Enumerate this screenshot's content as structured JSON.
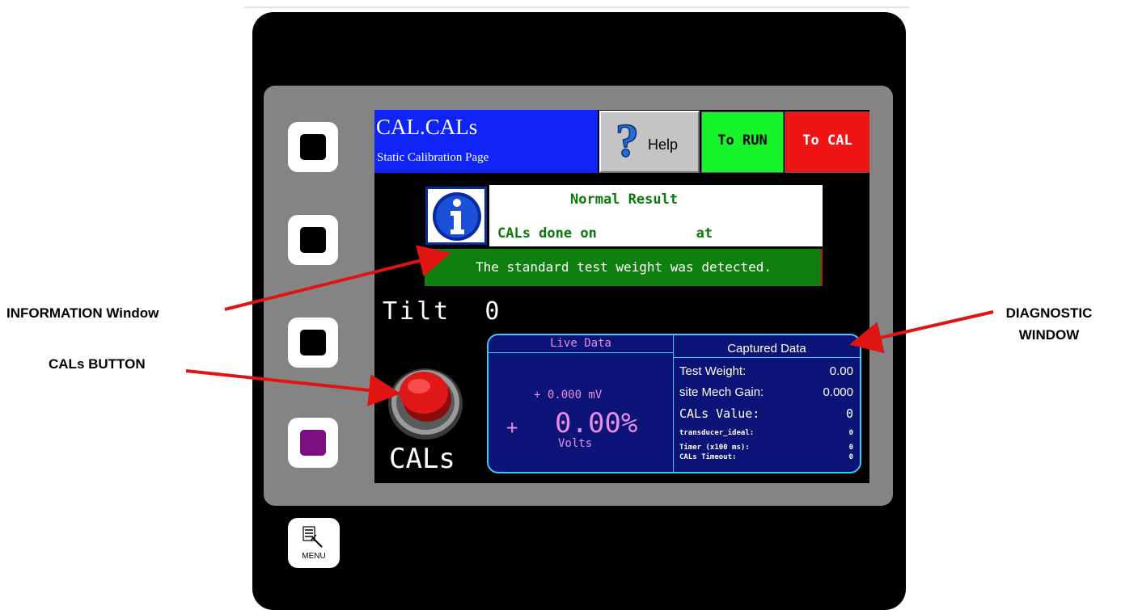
{
  "header": {
    "page_code": "CAL.CALs",
    "page_subtitle": "Static Calibration Page"
  },
  "buttons": {
    "help": "Help",
    "to_run": "To RUN",
    "to_cal": "To CAL",
    "cals": "CALs",
    "menu": "MENU"
  },
  "info": {
    "title": "Normal Result",
    "line": "CALs done on            at",
    "message": "The standard test weight was detected."
  },
  "tilt": "Tilt  0",
  "live_data": {
    "header": "Live Data",
    "mv_reading": "+ 0.000 mV",
    "sign": "+",
    "percent": "0.00%",
    "unit": "Volts"
  },
  "captured_data": {
    "header": "Captured Data",
    "rows": [
      {
        "label": "Test Weight:",
        "value": "0.00"
      },
      {
        "label": "site Mech Gain:",
        "value": "0.000"
      },
      {
        "label": "CALs Value:",
        "value": "0"
      },
      {
        "label": "transducer_ideal:",
        "value": "0"
      },
      {
        "label": "Timer (x100 ms):",
        "value": "0"
      },
      {
        "label": "CALs Timeout:",
        "value": "0"
      }
    ]
  },
  "annotations": {
    "information_window": "INFORMATION Window",
    "cals_button": "CALs BUTTON",
    "diagnostic_line1": "DIAGNOSTIC",
    "diagnostic_line2": "WINDOW"
  },
  "colors": {
    "title_bar": "#0f24f4",
    "to_run": "#17f42a",
    "to_cal": "#f01414",
    "info_message": "#0f7f0f",
    "diagnostic_bg": "#0c1477",
    "diagnostic_border": "#3fc7f6",
    "live_text": "#e88ce6",
    "arrow": "#e11414"
  }
}
